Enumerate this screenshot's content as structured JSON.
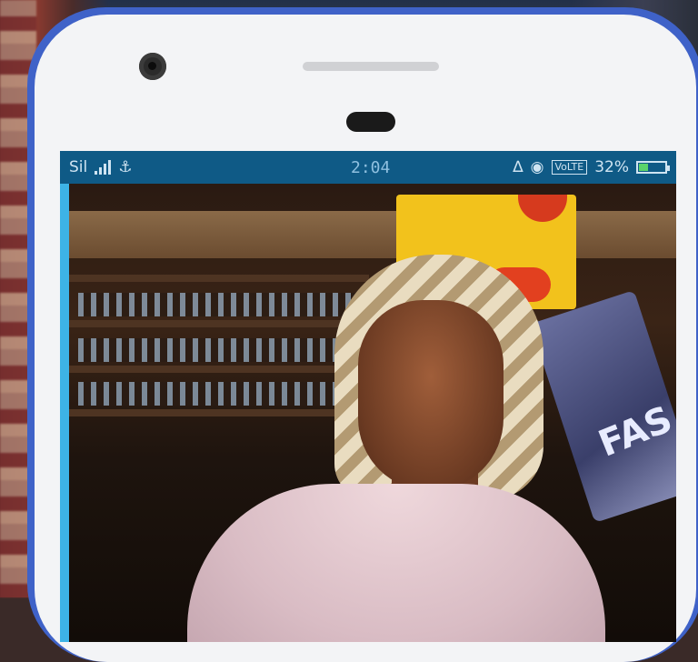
{
  "status_bar": {
    "time": "2:04",
    "icons": [
      "signal-icon",
      "signal-icon",
      "usb-icon",
      "alarm-icon",
      "eye-icon",
      "volte-icon",
      "battery-icon"
    ],
    "network_label": "Sil",
    "volte_label": "VoLTE",
    "battery_percent": "32%",
    "battery_level": 0.32
  },
  "photo": {
    "bag_text": "FAS"
  },
  "colors": {
    "phone_frame": "#3f62c8",
    "status_bar": "#0f5a86",
    "screen_edge": "#3db3e6"
  }
}
